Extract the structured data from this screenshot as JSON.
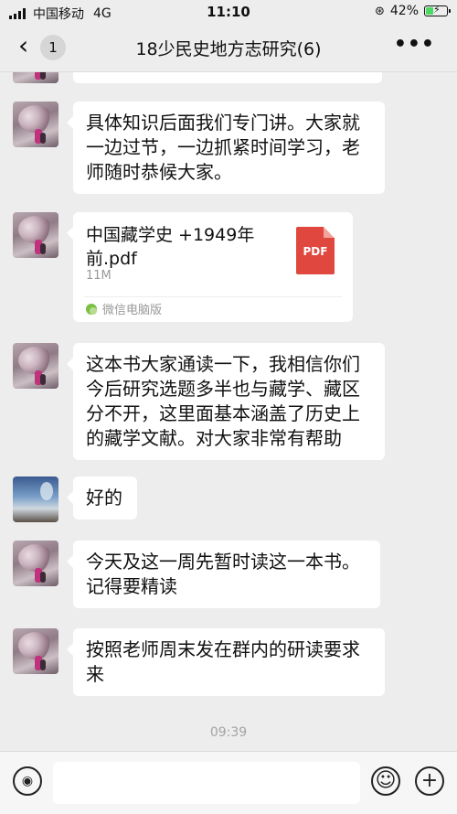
{
  "status_bar": {
    "carrier": "中国移动",
    "network": "4G",
    "time": "11:10",
    "battery_percent": "42%",
    "battery_level": 0.42
  },
  "header": {
    "back_icon": "chevron-left-icon",
    "unread_count": "1",
    "title": "18少民史地方志研究(6)",
    "more_icon": "more-dots-icon"
  },
  "messages": [
    {
      "type": "text",
      "text": "具体知识后面我们专门讲。大家就一边过节，一边抓紧时间学习，老师随时恭候大家。"
    },
    {
      "type": "file",
      "file_name": "中国藏学史 +1949年前.pdf",
      "file_size": "11M",
      "file_icon_label": "PDF",
      "source": "微信电脑版"
    },
    {
      "type": "text",
      "text": "这本书大家通读一下，我相信你们今后研究选题多半也与藏学、藏区分不开，这里面基本涵盖了历史上的藏学文献。对大家非常有帮助"
    },
    {
      "type": "text",
      "text": "好的"
    },
    {
      "type": "text",
      "text": "今天及这一周先暂时读这一本书。记得要精读"
    },
    {
      "type": "text",
      "text": "按照老师周末发在群内的研读要求来"
    }
  ],
  "timestamp": "09:39",
  "input_bar": {
    "voice_icon": "voice-icon",
    "emoji_icon": "emoji-icon",
    "plus_icon": "plus-icon",
    "emoji_glyph": "☺",
    "plus_glyph": "+",
    "voice_glyph": "◉"
  }
}
